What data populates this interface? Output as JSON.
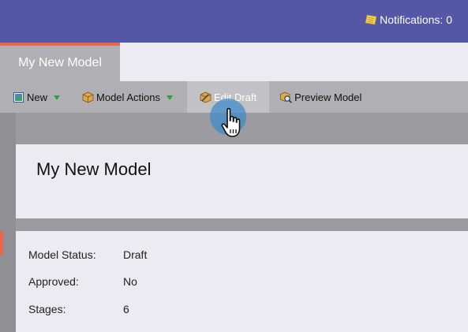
{
  "header": {
    "notifications_label": "Notifications: 0"
  },
  "tabs": [
    {
      "label": "My New Model",
      "active": true
    }
  ],
  "toolbar": {
    "new_label": "New",
    "model_actions_label": "Model Actions",
    "edit_draft_label": "Edit Draft",
    "preview_model_label": "Preview Model"
  },
  "main": {
    "title": "My New Model",
    "details": [
      {
        "label": "Model Status:",
        "value": "Draft"
      },
      {
        "label": "Approved:",
        "value": "No"
      },
      {
        "label": "Stages:",
        "value": "6"
      }
    ]
  },
  "colors": {
    "header_bg": "#5457a6",
    "accent": "#e8674a",
    "dropdown_indicator": "#27a33a",
    "cursor_highlight": "#408cc8"
  },
  "icons": {
    "notifications": "notepad-icon",
    "new": "new-document-icon",
    "model_actions": "box-icon",
    "edit_draft": "box-edit-icon",
    "preview_model": "magnifier-box-icon",
    "cursor": "hand-pointer-icon"
  }
}
